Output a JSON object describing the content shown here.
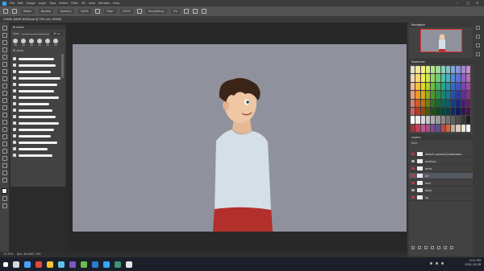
{
  "app": {
    "menu": [
      "File",
      "Edit",
      "Image",
      "Layer",
      "Type",
      "Select",
      "Filter",
      "3D",
      "View",
      "Window",
      "Help"
    ],
    "window_controls": [
      "–",
      "□",
      "✕"
    ]
  },
  "options_bar": {
    "mode_label": "Mode:",
    "mode_value": "Normal",
    "opacity_label": "Opacity:",
    "opacity_value": "100%",
    "flow_label": "Flow:",
    "flow_value": "100%",
    "smoothing_label": "Smoothing:",
    "smoothing_value": "0%"
  },
  "document_tab": {
    "title": "CHASE ANGIE BODY.psd @ 33% (ref, RGB/8)"
  },
  "brushes_panel": {
    "title": "Brushes",
    "size_label": "Size:",
    "size_value": "80 px",
    "preset_sizes": [
      "30",
      "30",
      "30",
      "25",
      "25",
      "36"
    ],
    "folder_label": "Brushes",
    "strokes": [
      44,
      46,
      40,
      52,
      48,
      44,
      50,
      38,
      42,
      46,
      50,
      44,
      40,
      48,
      36,
      42
    ]
  },
  "navigator": {
    "title": "Navigator"
  },
  "swatches": {
    "title": "Swatches",
    "colors": [
      "#e8e0c0",
      "#f2e59c",
      "#f5ef7a",
      "#d8ee7c",
      "#b6e28a",
      "#9bd99e",
      "#86d0b6",
      "#7ec3d1",
      "#7da8dc",
      "#8b92dd",
      "#a58ad6",
      "#c88fce",
      "#f4d7a8",
      "#f7d76d",
      "#f4ee4e",
      "#cde850",
      "#98d75f",
      "#6ecb76",
      "#4fc1a0",
      "#45b0c9",
      "#4d8bd9",
      "#6370d4",
      "#8d62c8",
      "#b867b8",
      "#f6b98a",
      "#f6c03a",
      "#e8d41e",
      "#b0d22c",
      "#6ec03c",
      "#3fb25a",
      "#24a888",
      "#2393b4",
      "#2d6dc6",
      "#4552bd",
      "#7247b2",
      "#a24aa2",
      "#f29b6e",
      "#ef9b22",
      "#d9a913",
      "#93ac1e",
      "#4e9a2c",
      "#278f45",
      "#13886e",
      "#137a96",
      "#1d56a6",
      "#30389c",
      "#5a3095",
      "#853085",
      "#e57b6a",
      "#d65a26",
      "#b8750f",
      "#6f8212",
      "#34711f",
      "#176a33",
      "#0a6652",
      "#0a5c73",
      "#113f82",
      "#20277a",
      "#431f74",
      "#671f66",
      "#d45c5c",
      "#b63b2a",
      "#8c4b0b",
      "#4e5a0c",
      "#1f4e15",
      "#0c4a24",
      "#044838",
      "#053f50",
      "#0a2b5c",
      "#131a55",
      "#2d1452",
      "#481448",
      "#ffffff",
      "#ececec",
      "#d8d8d8",
      "#c4c4c4",
      "#b0b0b0",
      "#9c9c9c",
      "#888888",
      "#747474",
      "#606060",
      "#4c4c4c",
      "#383838",
      "#202020",
      "#b32d3a",
      "#c53f5d",
      "#c4558a",
      "#a7508f",
      "#7a4e8e",
      "#5f4f8f",
      "#c24a3e",
      "#d06a3a",
      "#bfae9a",
      "#d9ccbd",
      "#ece4da",
      "#f6f2ec"
    ]
  },
  "layers": {
    "title": "Layers",
    "filter_label": "Kind",
    "items": [
      {
        "name": "default garment/underwear",
        "active": false,
        "eye": "red"
      },
      {
        "name": "overlays",
        "active": false,
        "eye": "normal"
      },
      {
        "name": "arms",
        "active": false,
        "eye": "red"
      },
      {
        "name": "ref",
        "active": true,
        "eye": "red"
      },
      {
        "name": "face",
        "active": false,
        "eye": "red"
      },
      {
        "name": "body",
        "active": false,
        "eye": "normal"
      },
      {
        "name": "bg",
        "active": false,
        "eye": "red"
      }
    ]
  },
  "status_bar": {
    "zoom": "33.33%",
    "doc_info": "Doc: 48.9M/1.79G"
  },
  "taskbar": {
    "time": "9:11 PM",
    "date": "2021-10-28",
    "icons": [
      "#d9d9d9",
      "#4ca0ff",
      "#e04a3a",
      "#f5c333",
      "#5ec2e8",
      "#7e57c2",
      "#6cbf4f",
      "#2e7bcf",
      "#31a8ff",
      "#3d9970",
      "#e5e5e5"
    ]
  }
}
